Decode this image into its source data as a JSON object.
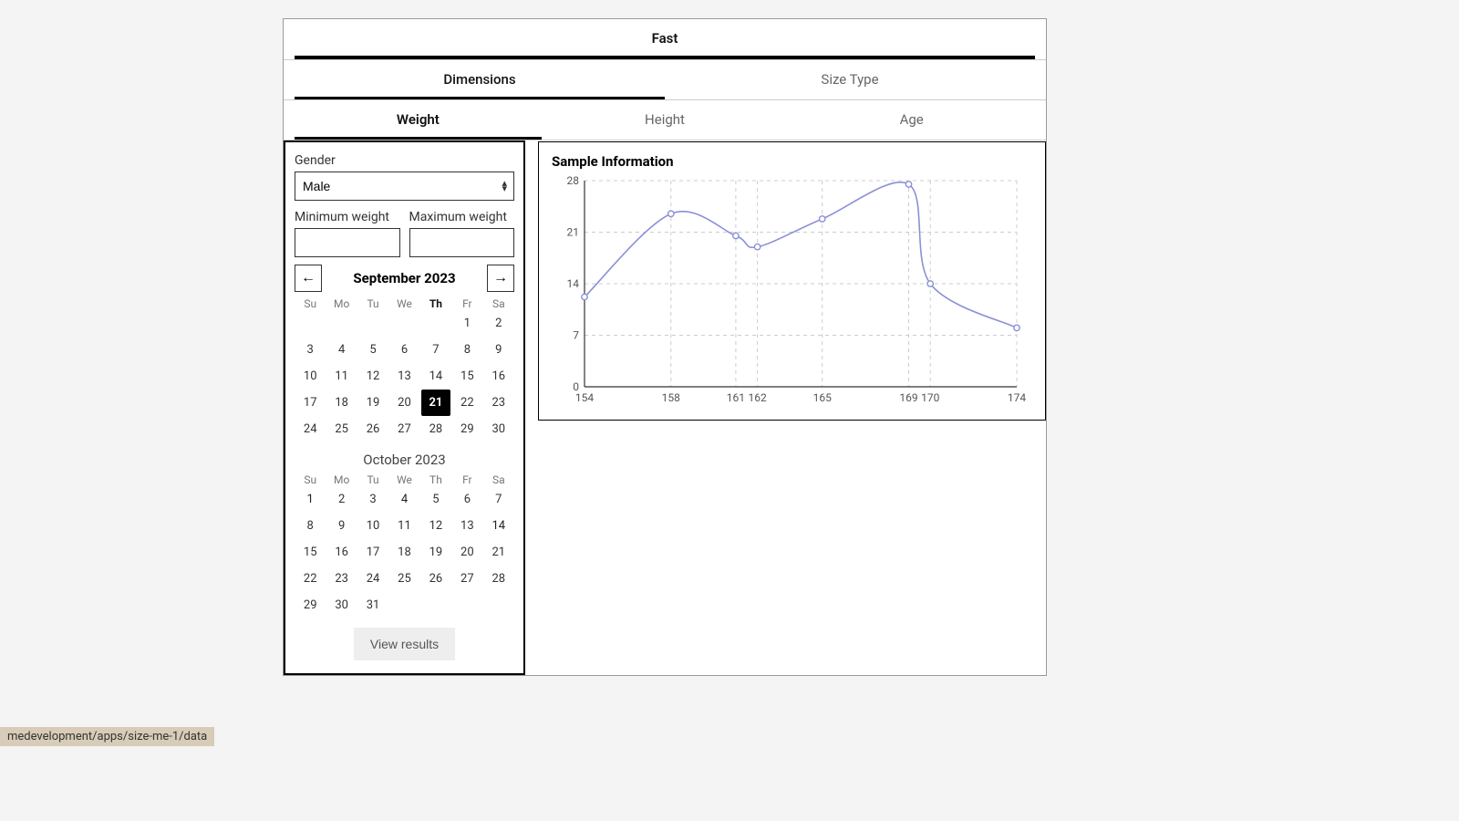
{
  "tabs_primary": [
    {
      "label": "Fast",
      "active": true
    }
  ],
  "tabs_secondary": [
    {
      "label": "Dimensions",
      "active": true
    },
    {
      "label": "Size Type",
      "active": false
    }
  ],
  "tabs_tertiary": [
    {
      "label": "Weight",
      "active": true
    },
    {
      "label": "Height",
      "active": false
    },
    {
      "label": "Age",
      "active": false
    }
  ],
  "form": {
    "gender_label": "Gender",
    "gender_value": "Male",
    "min_weight_label": "Minimum weight",
    "min_weight_value": "",
    "max_weight_label": "Maximum weight",
    "max_weight_value": "",
    "view_button": "View results"
  },
  "calendar": {
    "dow": [
      "Su",
      "Mo",
      "Tu",
      "We",
      "Th",
      "Fr",
      "Sa"
    ],
    "month1": {
      "title": "September 2023",
      "lead_blanks": 5,
      "days": 30,
      "selected": 21,
      "today_col": 4
    },
    "month2": {
      "title": "October 2023",
      "lead_blanks": 0,
      "days": 31,
      "alt_days": [
        1,
        4,
        14
      ]
    }
  },
  "chart_data": {
    "type": "line",
    "title": "Sample Information",
    "x": [
      154,
      158,
      161,
      162,
      165,
      169,
      170,
      174
    ],
    "values": [
      12.2,
      23.5,
      20.5,
      19,
      22.8,
      27.5,
      14,
      8
    ],
    "ylim": [
      0,
      28
    ],
    "yticks": [
      0,
      7,
      14,
      21,
      28
    ],
    "xticks": [
      154,
      158,
      161,
      162,
      165,
      169,
      170,
      174
    ]
  },
  "status_text": "medevelopment/apps/size-me-1/data"
}
